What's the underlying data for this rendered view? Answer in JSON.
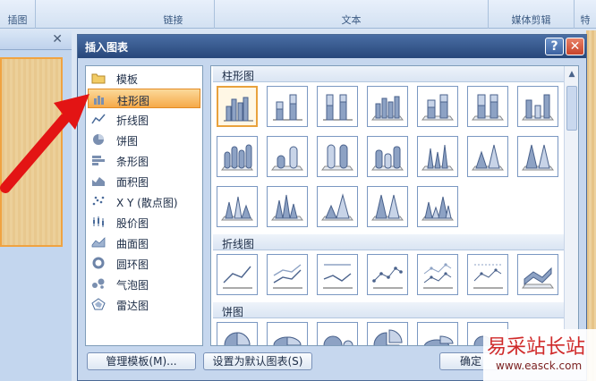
{
  "ribbon": {
    "groups": [
      "插图",
      "链接",
      "文本",
      "媒体剪辑",
      "特"
    ]
  },
  "dialog": {
    "title": "插入图表",
    "help_label": "?",
    "close_label": "✕"
  },
  "categories": [
    {
      "label": "模板",
      "icon": "folder-icon"
    },
    {
      "label": "柱形图",
      "icon": "column-chart-icon",
      "selected": true
    },
    {
      "label": "折线图",
      "icon": "line-chart-icon"
    },
    {
      "label": "饼图",
      "icon": "pie-chart-icon"
    },
    {
      "label": "条形图",
      "icon": "bar-chart-icon"
    },
    {
      "label": "面积图",
      "icon": "area-chart-icon"
    },
    {
      "label": "X Y (散点图)",
      "icon": "scatter-chart-icon"
    },
    {
      "label": "股价图",
      "icon": "stock-chart-icon"
    },
    {
      "label": "曲面图",
      "icon": "surface-chart-icon"
    },
    {
      "label": "圆环图",
      "icon": "doughnut-chart-icon"
    },
    {
      "label": "气泡图",
      "icon": "bubble-chart-icon"
    },
    {
      "label": "雷达图",
      "icon": "radar-chart-icon"
    }
  ],
  "sections": {
    "column": "柱形图",
    "line": "折线图",
    "pie": "饼图"
  },
  "buttons": {
    "manage_templates": "管理模板(M)...",
    "set_default": "设置为默认图表(S)",
    "ok": "确定"
  },
  "watermark": {
    "title": "易采站长站",
    "url": "www.easck.com"
  },
  "colors": {
    "selection_orange": "#f6a949",
    "title_bar_blue": "#27477a",
    "arrow_red": "#e31414"
  }
}
